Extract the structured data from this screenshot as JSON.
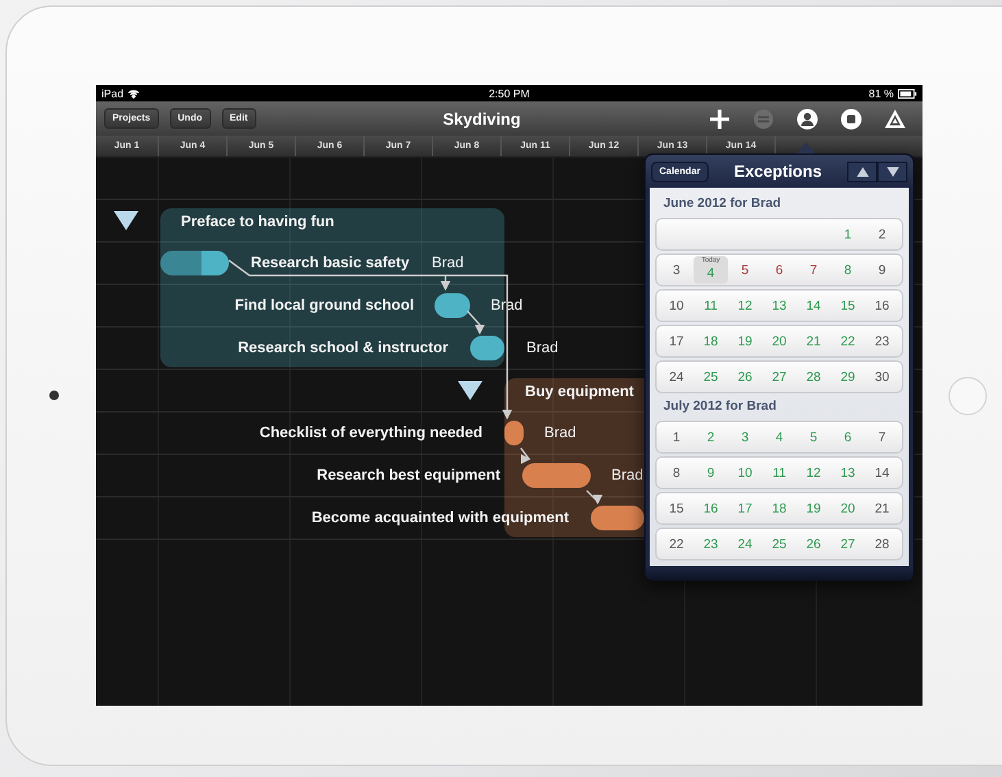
{
  "status_bar": {
    "device": "iPad",
    "time": "2:50 PM",
    "battery": "81 %"
  },
  "toolbar": {
    "buttons": [
      "Projects",
      "Undo",
      "Edit"
    ],
    "title": "Skydiving",
    "tools": [
      {
        "kind": "plus",
        "disabled": false
      },
      {
        "kind": "minus-circle",
        "disabled": true
      },
      {
        "kind": "person",
        "disabled": false
      },
      {
        "kind": "stop",
        "disabled": false
      },
      {
        "kind": "triangle",
        "disabled": false
      }
    ]
  },
  "dates": [
    "Jun 1",
    "Jun 4",
    "Jun 5",
    "Jun 6",
    "Jun 7",
    "Jun 8",
    "Jun 11",
    "Jun 12",
    "Jun 13",
    "Jun 14"
  ],
  "groups": [
    {
      "name": "Preface to having fun",
      "color": "#4fb3c6",
      "expanded": true,
      "children": [
        {
          "name": "Research basic safety",
          "assignee": "Brad",
          "level": 0.6
        },
        {
          "name": "Find local ground school",
          "assignee": "Brad"
        },
        {
          "name": "Research school & instructor",
          "assignee": "Brad"
        }
      ]
    },
    {
      "name": "Buy equipment",
      "color": "#d9804f",
      "expanded": true,
      "children": [
        {
          "name": "Checklist of everything needed",
          "assignee": "Brad"
        },
        {
          "name": "Research best equipment",
          "assignee": "Brad"
        },
        {
          "name": "Become acquainted with equipment"
        }
      ]
    }
  ],
  "popover": {
    "back_button": "Calendar",
    "title": "Exceptions",
    "months": [
      {
        "title": "June 2012 for Brad",
        "weeks": [
          [
            {
              "kind": "blank"
            },
            {
              "kind": "blank"
            },
            {
              "kind": "blank"
            },
            {
              "kind": "blank"
            },
            {
              "kind": "blank"
            },
            {
              "kind": "day",
              "day": "1",
              "color": "#2e9a4f"
            },
            {
              "kind": "day",
              "day": "2",
              "color": "#555555"
            }
          ],
          [
            {
              "kind": "day",
              "day": "3",
              "color": "#555555"
            },
            {
              "kind": "day",
              "day": "4",
              "color": "#2e9a4f",
              "note": "Today"
            },
            {
              "kind": "day",
              "day": "5",
              "color": "#a83a3a"
            },
            {
              "kind": "day",
              "day": "6",
              "color": "#a83a3a"
            },
            {
              "kind": "day",
              "day": "7",
              "color": "#a83a3a"
            },
            {
              "kind": "day",
              "day": "8",
              "color": "#2e9a4f"
            },
            {
              "kind": "day",
              "day": "9",
              "color": "#555555"
            }
          ],
          [
            {
              "kind": "day",
              "day": "10",
              "color": "#555555"
            },
            {
              "kind": "day",
              "day": "11",
              "color": "#2e9a4f"
            },
            {
              "kind": "day",
              "day": "12",
              "color": "#2e9a4f"
            },
            {
              "kind": "day",
              "day": "13",
              "color": "#2e9a4f"
            },
            {
              "kind": "day",
              "day": "14",
              "color": "#2e9a4f"
            },
            {
              "kind": "day",
              "day": "15",
              "color": "#2e9a4f"
            },
            {
              "kind": "day",
              "day": "16",
              "color": "#555555"
            }
          ],
          [
            {
              "kind": "day",
              "day": "17",
              "color": "#555555"
            },
            {
              "kind": "day",
              "day": "18",
              "color": "#2e9a4f"
            },
            {
              "kind": "day",
              "day": "19",
              "color": "#2e9a4f"
            },
            {
              "kind": "day",
              "day": "20",
              "color": "#2e9a4f"
            },
            {
              "kind": "day",
              "day": "21",
              "color": "#2e9a4f"
            },
            {
              "kind": "day",
              "day": "22",
              "color": "#2e9a4f"
            },
            {
              "kind": "day",
              "day": "23",
              "color": "#555555"
            }
          ],
          [
            {
              "kind": "day",
              "day": "24",
              "color": "#555555"
            },
            {
              "kind": "day",
              "day": "25",
              "color": "#2e9a4f"
            },
            {
              "kind": "day",
              "day": "26",
              "color": "#2e9a4f"
            },
            {
              "kind": "day",
              "day": "27",
              "color": "#2e9a4f"
            },
            {
              "kind": "day",
              "day": "28",
              "color": "#2e9a4f"
            },
            {
              "kind": "day",
              "day": "29",
              "color": "#2e9a4f"
            },
            {
              "kind": "day",
              "day": "30",
              "color": "#555555"
            }
          ]
        ]
      },
      {
        "title": "July 2012 for Brad",
        "weeks": [
          [
            {
              "kind": "day",
              "day": "1",
              "color": "#555555"
            },
            {
              "kind": "day",
              "day": "2",
              "color": "#2e9a4f"
            },
            {
              "kind": "day",
              "day": "3",
              "color": "#2e9a4f"
            },
            {
              "kind": "day",
              "day": "4",
              "color": "#2e9a4f"
            },
            {
              "kind": "day",
              "day": "5",
              "color": "#2e9a4f"
            },
            {
              "kind": "day",
              "day": "6",
              "color": "#2e9a4f"
            },
            {
              "kind": "day",
              "day": "7",
              "color": "#555555"
            }
          ],
          [
            {
              "kind": "day",
              "day": "8",
              "color": "#555555"
            },
            {
              "kind": "day",
              "day": "9",
              "color": "#2e9a4f"
            },
            {
              "kind": "day",
              "day": "10",
              "color": "#2e9a4f"
            },
            {
              "kind": "day",
              "day": "11",
              "color": "#2e9a4f"
            },
            {
              "kind": "day",
              "day": "12",
              "color": "#2e9a4f"
            },
            {
              "kind": "day",
              "day": "13",
              "color": "#2e9a4f"
            },
            {
              "kind": "day",
              "day": "14",
              "color": "#555555"
            }
          ],
          [
            {
              "kind": "day",
              "day": "15",
              "color": "#555555"
            },
            {
              "kind": "day",
              "day": "16",
              "color": "#2e9a4f"
            },
            {
              "kind": "day",
              "day": "17",
              "color": "#2e9a4f"
            },
            {
              "kind": "day",
              "day": "18",
              "color": "#2e9a4f"
            },
            {
              "kind": "day",
              "day": "19",
              "color": "#2e9a4f"
            },
            {
              "kind": "day",
              "day": "20",
              "color": "#2e9a4f"
            },
            {
              "kind": "day",
              "day": "21",
              "color": "#555555"
            }
          ],
          [
            {
              "kind": "day",
              "day": "22",
              "color": "#555555"
            },
            {
              "kind": "day",
              "day": "23",
              "color": "#2e9a4f"
            },
            {
              "kind": "day",
              "day": "24",
              "color": "#2e9a4f"
            },
            {
              "kind": "day",
              "day": "25",
              "color": "#2e9a4f"
            },
            {
              "kind": "day",
              "day": "26",
              "color": "#2e9a4f"
            },
            {
              "kind": "day",
              "day": "27",
              "color": "#2e9a4f"
            },
            {
              "kind": "day",
              "day": "28",
              "color": "#555555"
            }
          ]
        ]
      }
    ]
  }
}
